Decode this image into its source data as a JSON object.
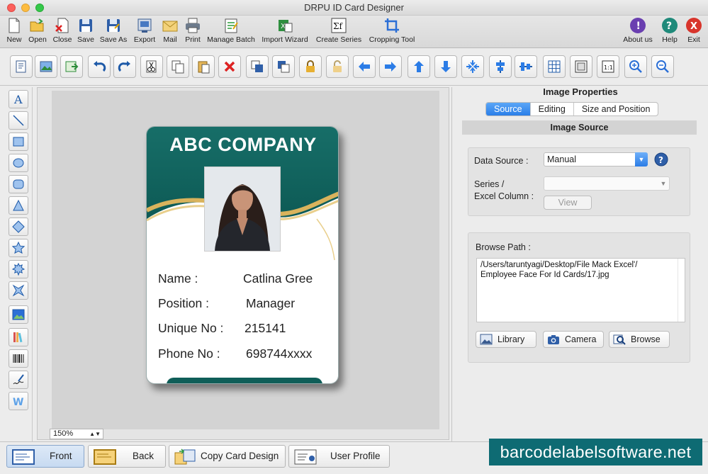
{
  "window": {
    "title": "DRPU ID Card Designer"
  },
  "toolbar": [
    {
      "id": "new",
      "label": "New",
      "icon": "new-document-icon"
    },
    {
      "id": "open",
      "label": "Open",
      "icon": "open-folder-icon"
    },
    {
      "id": "close",
      "label": "Close",
      "icon": "close-document-icon"
    },
    {
      "id": "save",
      "label": "Save",
      "icon": "save-icon"
    },
    {
      "id": "save-as",
      "label": "Save As",
      "icon": "save-as-icon"
    },
    {
      "id": "export",
      "label": "Export",
      "icon": "export-icon"
    },
    {
      "id": "mail",
      "label": "Mail",
      "icon": "mail-icon"
    },
    {
      "id": "print",
      "label": "Print",
      "icon": "printer-icon"
    },
    {
      "id": "manage-batch",
      "label": "Manage Batch",
      "icon": "manage-batch-icon"
    },
    {
      "id": "import-wizard",
      "label": "Import Wizard",
      "icon": "import-wizard-icon"
    },
    {
      "id": "create-series",
      "label": "Create Series",
      "icon": "create-series-icon"
    },
    {
      "id": "cropping-tool",
      "label": "Cropping Tool",
      "icon": "crop-icon"
    },
    {
      "id": "about-us",
      "label": "About us",
      "icon": "info-icon"
    },
    {
      "id": "help",
      "label": "Help",
      "icon": "help-icon"
    },
    {
      "id": "exit",
      "label": "Exit",
      "icon": "exit-icon"
    }
  ],
  "canvas": {
    "zoom": "150%"
  },
  "card": {
    "company": "ABC COMPANY",
    "rows": [
      {
        "label": "Name :",
        "value": "Catlina Gree"
      },
      {
        "label": "Position :",
        "value": "Manager"
      },
      {
        "label": "Unique No :",
        "value": "215141"
      },
      {
        "label": "Phone No :",
        "value": "698744xxxx"
      }
    ],
    "colors": {
      "header": "#176e68",
      "accent": "#d9b35c"
    }
  },
  "properties": {
    "title": "Image Properties",
    "tabs": [
      "Source",
      "Editing",
      "Size and Position"
    ],
    "active_tab": "Source",
    "section": "Image Source",
    "data_source_label": "Data Source :",
    "data_source_value": "Manual",
    "series_label_1": "Series /",
    "series_label_2": "Excel Column :",
    "series_value": "",
    "view_button": "View",
    "browse_path_label": "Browse Path :",
    "browse_path_line1": "/Users/taruntyagi/Desktop/File Mack  Excel'/",
    "browse_path_line2": "Employee Face For Id Cards/17.jpg",
    "library_button": "Library",
    "camera_button": "Camera",
    "browse_button": "Browse"
  },
  "bottom": {
    "front": "Front",
    "back": "Back",
    "copy_card_design": "Copy Card Design",
    "user_profile": "User Profile",
    "brand": "barcodelabelsoftware.net"
  }
}
